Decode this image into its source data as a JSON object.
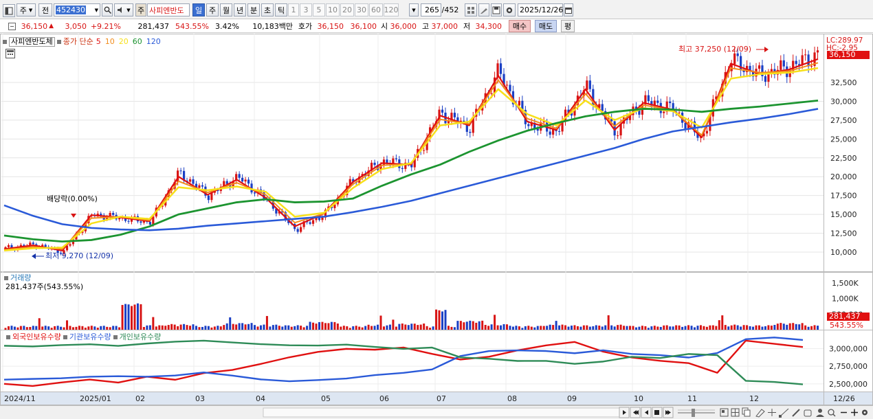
{
  "toolbar": {
    "market_label": "주",
    "prev_label": "전",
    "code": "452430",
    "stock_tag": "주",
    "stock_name": "사피엔반도",
    "periods": [
      {
        "label": "일",
        "active": true
      },
      {
        "label": "주",
        "active": false
      },
      {
        "label": "월",
        "active": false
      },
      {
        "label": "년",
        "active": false
      },
      {
        "label": "분",
        "active": false
      },
      {
        "label": "초",
        "active": false
      },
      {
        "label": "틱",
        "active": false
      }
    ],
    "intervals": [
      "1",
      "3",
      "5",
      "10",
      "20",
      "30",
      "60",
      "120"
    ],
    "count": "265",
    "total": "/452",
    "date": "2025/12/26"
  },
  "quote": {
    "price": "36,150",
    "arrow": "▲",
    "change": "3,050",
    "change_pct": "+9.21%",
    "volume": "281,437",
    "volume_ratio": "543.55%",
    "turnover": "3.42%",
    "amount": "10,183백만",
    "ask_label": "호가",
    "ask1": "36,150",
    "ask2": "36,100",
    "open_label": "시",
    "open": "36,000",
    "high_label": "고",
    "high": "37,000",
    "low_label": "저",
    "low": "34,300",
    "buy_label": "매수",
    "sell_label": "매도",
    "avg_label": "평"
  },
  "price_pane": {
    "name": "사피엔반도체",
    "ma_label": "종가 단순",
    "ma_periods": [
      {
        "label": "5",
        "color": "#e01010"
      },
      {
        "label": "10",
        "color": "#f28c1c"
      },
      {
        "label": "20",
        "color": "#f7e01a"
      },
      {
        "label": "60",
        "color": "#1c9430"
      },
      {
        "label": "120",
        "color": "#2a5ad8"
      }
    ],
    "dividend_note": "배당락(0.00%)",
    "max_note": "최고 37,250 (12/09)",
    "min_note": "최저 9,270 (12/09)",
    "lc_label": "LC:289.97",
    "hc_label": "HC:-2.95",
    "last_price_tag": "36,150",
    "last_pct_tag": "9.21%",
    "y_axis": [
      {
        "label": "32,500",
        "v": 32500
      },
      {
        "label": "30,000",
        "v": 30000
      },
      {
        "label": "27,500",
        "v": 27500
      },
      {
        "label": "25,000",
        "v": 25000
      },
      {
        "label": "22,500",
        "v": 22500
      },
      {
        "label": "20,000",
        "v": 20000
      },
      {
        "label": "17,500",
        "v": 17500
      },
      {
        "label": "15,000",
        "v": 15000
      },
      {
        "label": "12,500",
        "v": 12500
      },
      {
        "label": "10,000",
        "v": 10000
      }
    ]
  },
  "volume_pane": {
    "name": "거래량",
    "value_label": "281,437주(543.55%)",
    "y_axis": [
      {
        "label": "1,500K",
        "v": 1500
      },
      {
        "label": "1,000K",
        "v": 1000
      },
      {
        "label": "500,000",
        "v": 500
      }
    ],
    "last_tag": "281,437",
    "last_pct_tag": "543.55%"
  },
  "holdings_pane": {
    "series": [
      {
        "name": "외국인보유수량",
        "color": "#e01010"
      },
      {
        "name": "기관보유수량",
        "color": "#2a5ad8"
      },
      {
        "name": "개인보유수량",
        "color": "#2e8b57"
      }
    ],
    "y_axis": [
      {
        "label": "3,000,000",
        "v": 3000000
      },
      {
        "label": "2,750,000",
        "v": 2750000
      },
      {
        "label": "2,500,000",
        "v": 2500000
      }
    ]
  },
  "time_axis": {
    "ticks": [
      {
        "label": "2024/11"
      },
      {
        "label": "2025/01"
      },
      {
        "label": "02"
      },
      {
        "label": "03"
      },
      {
        "label": "04"
      },
      {
        "label": "05"
      },
      {
        "label": "06"
      },
      {
        "label": "07"
      },
      {
        "label": "08"
      },
      {
        "label": "09"
      },
      {
        "label": "10"
      },
      {
        "label": "11"
      },
      {
        "label": "12"
      }
    ],
    "last_label": "12/26"
  },
  "chart_data": {
    "type": "line",
    "series": [
      {
        "name": "사피엔반도체",
        "values": [
          10500,
          11000,
          10000,
          15000,
          14500,
          14000,
          20500,
          17500,
          20000,
          17000,
          13000,
          15000,
          19500,
          22000,
          21500,
          28500,
          26500,
          34000,
          27000,
          26000,
          32000,
          26000,
          30000,
          29000,
          25000,
          35500,
          33500,
          34500,
          36150
        ]
      },
      {
        "name": "5",
        "values": [
          10400,
          10900,
          10200,
          14900,
          14600,
          14100,
          20000,
          17600,
          19600,
          17200,
          13400,
          15100,
          19300,
          21800,
          21600,
          28100,
          26800,
          33400,
          27300,
          26200,
          31600,
          26200,
          29800,
          28900,
          25200,
          35000,
          33600,
          34200,
          35600
        ]
      },
      {
        "name": "10",
        "values": [
          10300,
          10700,
          10400,
          14500,
          14700,
          14200,
          19400,
          17900,
          19200,
          17600,
          13900,
          15100,
          19000,
          21500,
          21700,
          27600,
          27000,
          32800,
          27700,
          26400,
          31000,
          26700,
          29500,
          28800,
          25500,
          34400,
          33800,
          34000,
          35100
        ]
      },
      {
        "name": "20",
        "values": [
          10200,
          10500,
          10600,
          13800,
          14700,
          14400,
          18600,
          18200,
          18700,
          18000,
          14700,
          15200,
          18500,
          21000,
          21800,
          26800,
          27300,
          31600,
          28300,
          26800,
          30100,
          27500,
          29100,
          28700,
          26500,
          33000,
          33600,
          33800,
          34400
        ]
      },
      {
        "name": "60",
        "values": [
          12200,
          11700,
          11400,
          11600,
          12300,
          13400,
          15000,
          15800,
          16600,
          17000,
          16600,
          16700,
          17100,
          18800,
          20300,
          21600,
          23300,
          24800,
          26100,
          27100,
          28000,
          28600,
          29000,
          28900,
          28600,
          29000,
          29300,
          29700,
          30100
        ]
      },
      {
        "name": "120",
        "values": [
          16200,
          14800,
          13700,
          13200,
          13000,
          12900,
          13100,
          13500,
          13800,
          14100,
          14400,
          14700,
          15300,
          16000,
          16800,
          17800,
          18800,
          19800,
          20800,
          21800,
          22800,
          23800,
          25000,
          26000,
          26600,
          27200,
          27700,
          28300,
          29000
        ]
      }
    ],
    "volume_values": [
      1,
      1,
      1,
      1,
      1,
      2,
      4,
      1,
      6,
      3,
      2,
      8,
      1,
      3,
      5,
      1,
      10,
      4,
      1,
      3,
      2,
      3,
      1,
      2,
      2,
      3,
      2,
      6,
      2
    ],
    "holdings_ticks": [
      2500000,
      2750000,
      3000000
    ]
  }
}
